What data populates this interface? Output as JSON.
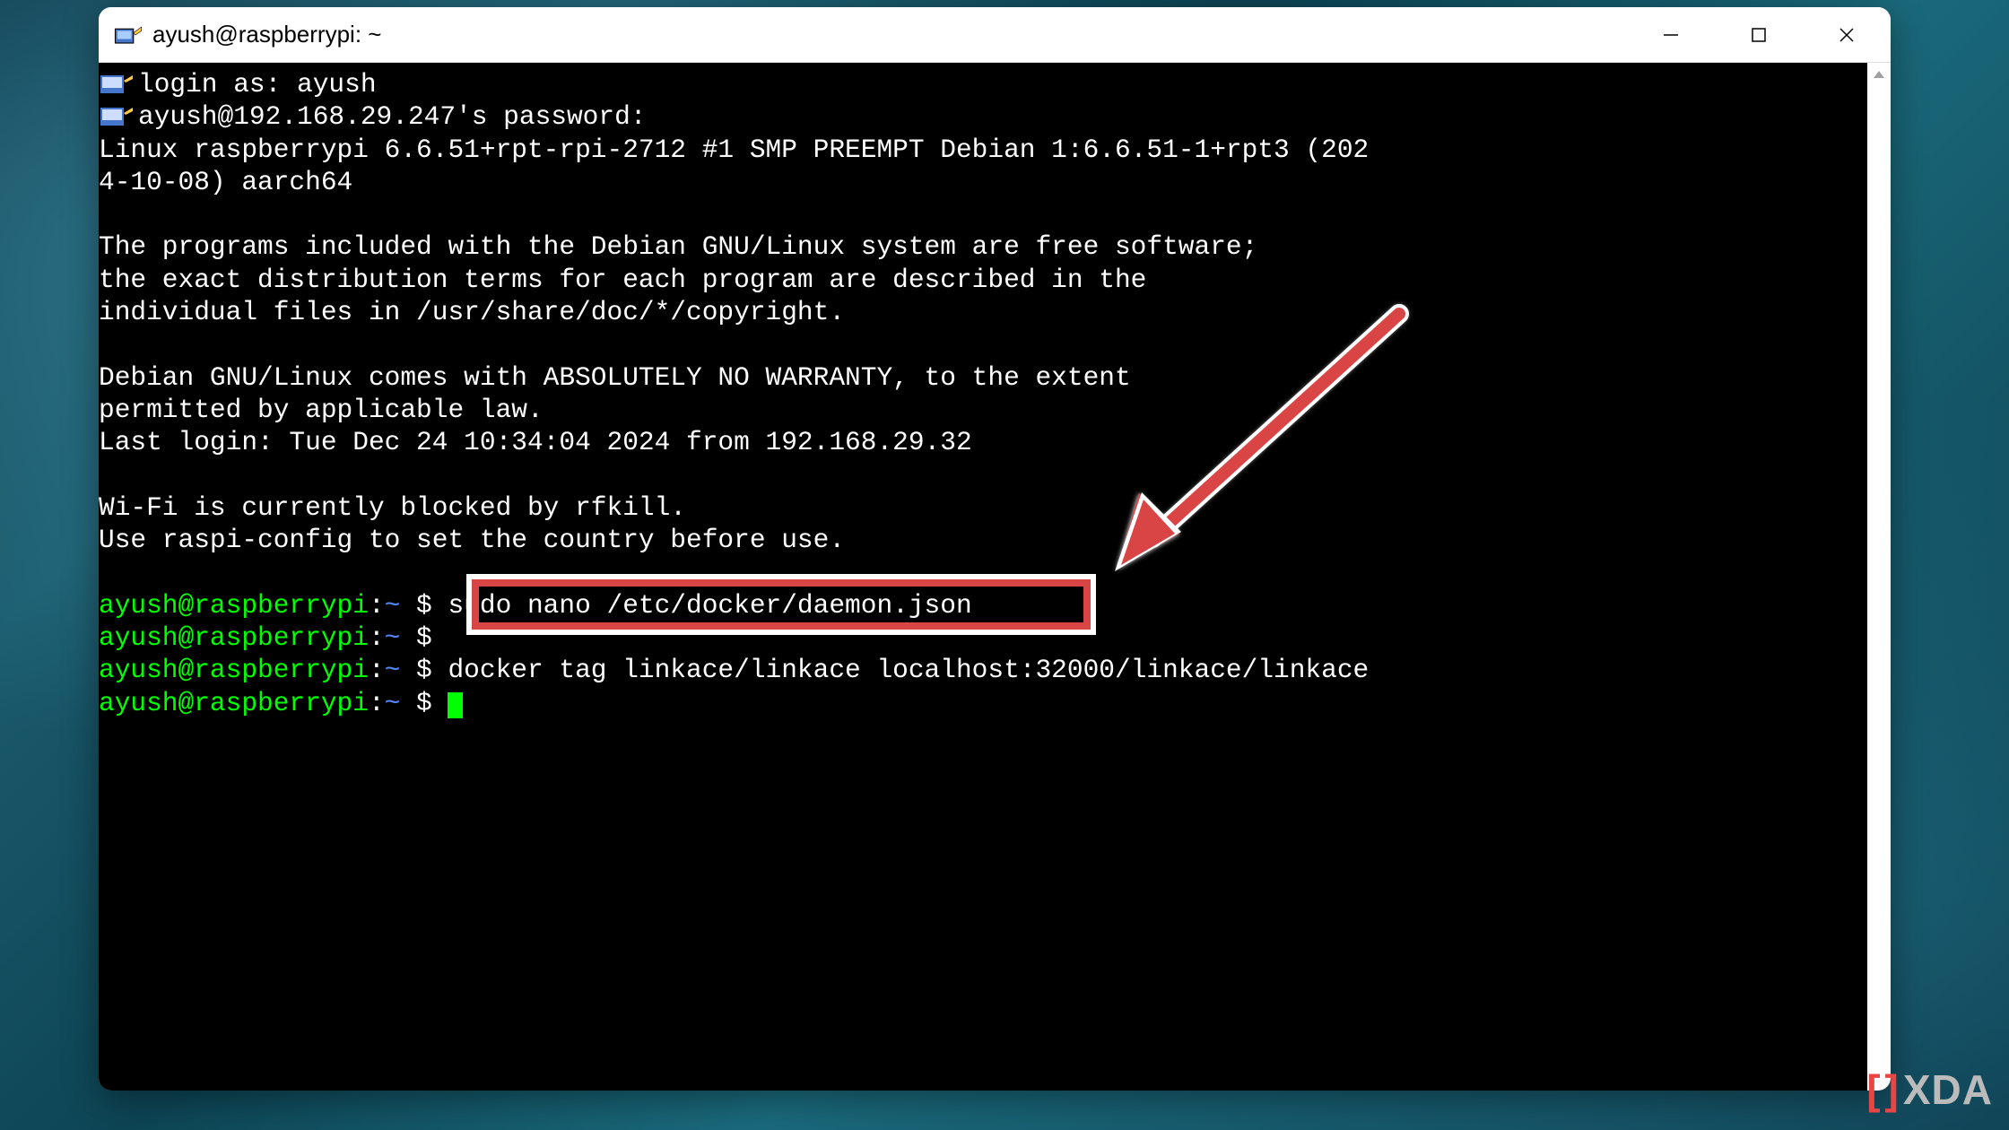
{
  "window": {
    "title": "ayush@raspberrypi: ~"
  },
  "terminal": {
    "login_prompt": "login as: ayush",
    "password_prompt": "ayush@192.168.29.247's password:",
    "banner_line1": "Linux raspberrypi 6.6.51+rpt-rpi-2712 #1 SMP PREEMPT Debian 1:6.6.51-1+rpt3 (202",
    "banner_line2": "4-10-08) aarch64",
    "debian_msg1": "The programs included with the Debian GNU/Linux system are free software;",
    "debian_msg2": "the exact distribution terms for each program are described in the",
    "debian_msg3": "individual files in /usr/share/doc/*/copyright.",
    "warranty_line1": "Debian GNU/Linux comes with ABSOLUTELY NO WARRANTY, to the extent",
    "warranty_line2": "permitted by applicable law.",
    "last_login": "Last login: Tue Dec 24 10:34:04 2024 from 192.168.29.32",
    "wifi_line1": "Wi-Fi is currently blocked by rfkill.",
    "wifi_line2": "Use raspi-config to set the country before use.",
    "prompt": {
      "user_host": "ayush@raspberrypi",
      "separator": ":",
      "path": "~",
      "dollar": " $ "
    },
    "commands": {
      "cmd1": "sudo nano /etc/docker/daemon.json",
      "cmd2_hidden": "",
      "cmd3": "docker tag linkace/linkace localhost:32000/linkace/linkace"
    }
  },
  "watermark": {
    "text": "XDA"
  }
}
